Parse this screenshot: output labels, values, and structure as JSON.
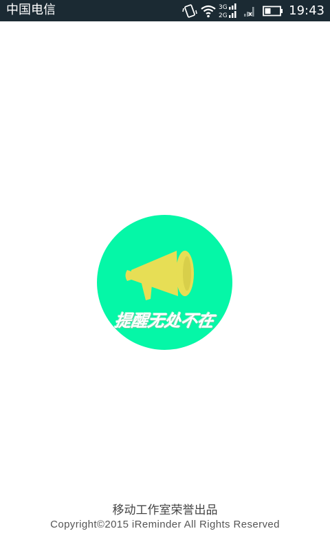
{
  "status_bar": {
    "carrier": "中国电信",
    "network_3g": "3G",
    "network_2g": "2G",
    "time": "19:43",
    "icons": [
      "vibrate-icon",
      "wifi-icon",
      "signal-icon",
      "no-sim-signal-icon",
      "battery-icon"
    ]
  },
  "splash": {
    "slogan": "提醒无处不在",
    "colors": {
      "circle": "#05f7a7",
      "megaphone": "#e7de55"
    }
  },
  "footer": {
    "studio": "移动工作室荣誉出品",
    "copyright": "Copyright©2015 iReminder All Rights Reserved"
  }
}
